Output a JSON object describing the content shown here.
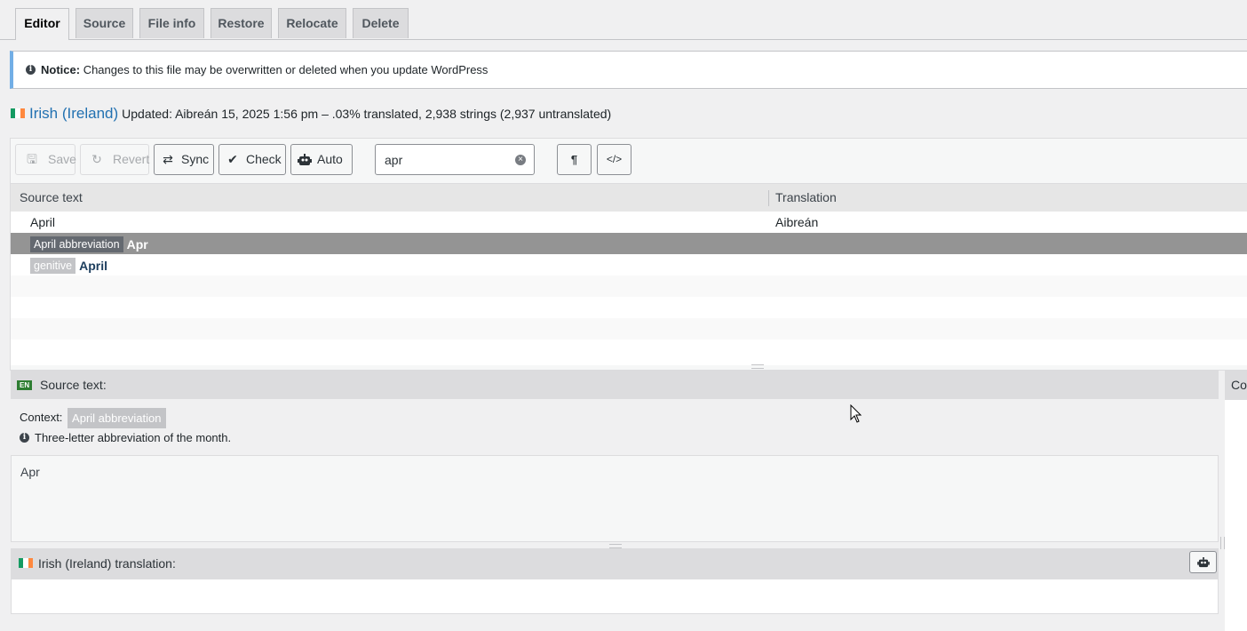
{
  "tabs": [
    {
      "label": "Editor",
      "active": true
    },
    {
      "label": "Source"
    },
    {
      "label": "File info"
    },
    {
      "label": "Restore"
    },
    {
      "label": "Relocate"
    },
    {
      "label": "Delete"
    }
  ],
  "notice": {
    "label": "Notice:",
    "text": "Changes to this file may be overwritten or deleted when you update WordPress"
  },
  "heading": {
    "language": "Irish (Ireland)",
    "meta": "Updated: Aibreán 15, 2025 1:56 pm – .03% translated, 2,938 strings (2,937 untranslated)"
  },
  "toolbar": {
    "save": "Save",
    "revert": "Revert",
    "sync": "Sync",
    "check": "Check",
    "auto": "Auto",
    "search_value": "apr",
    "pilcrow": "¶",
    "code": "</>"
  },
  "grid": {
    "col_source": "Source text",
    "col_translation": "Translation",
    "rows": [
      {
        "source": "April",
        "translation": "Aibreán"
      },
      {
        "context": "April abbreviation",
        "source": "Apr",
        "translation": "",
        "selected": true
      },
      {
        "context": "genitive",
        "source": "April",
        "translation": ""
      }
    ]
  },
  "source_panel": {
    "badge": "EN",
    "title": "Source text:",
    "context_label": "Context:",
    "context_value": "April abbreviation",
    "note": "Three-letter abbreviation of the month.",
    "text": "Apr"
  },
  "translation_panel": {
    "title": "Irish (Ireland) translation:"
  },
  "side_panel": {
    "title": "Co"
  },
  "colors": {
    "flag_green": "#169b62",
    "flag_white": "#ffffff",
    "flag_orange": "#ff883e",
    "link": "#2271b1",
    "selected_row": "#949494"
  }
}
